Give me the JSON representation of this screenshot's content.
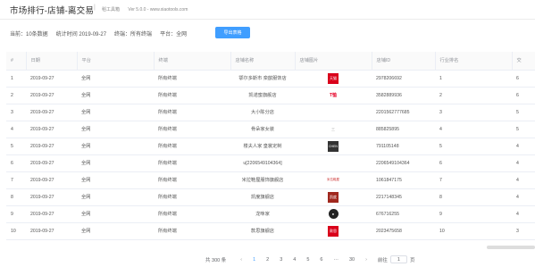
{
  "header": {
    "title": "市场排行-店铺-离交易",
    "separator": "|",
    "tool_name": "稻工具箱",
    "version": "Ver 5.0.0 - www.xiaotools.com"
  },
  "summary": {
    "current": "当前：10条数据",
    "stat_time": "统计时间 2019-09-27",
    "terminal": "终端：所有终端",
    "platform": "平台：全网",
    "export_label": "导出表格"
  },
  "table": {
    "columns": [
      "#",
      "日期",
      "平台",
      "终端",
      "店铺名称",
      "店铺图片",
      "店铺ID",
      "行业排名",
      "交"
    ],
    "rows": [
      {
        "idx": "1",
        "date": "2019-09-27",
        "platform": "全网",
        "terminal": "所有终端",
        "shop": "鄂尔多斯市 栾歆服饰店",
        "logo": "天猫",
        "logo_style": "red",
        "shop_id": "2978206692",
        "rank": "1",
        "extra": "6"
      },
      {
        "idx": "2",
        "date": "2019-09-27",
        "platform": "全网",
        "terminal": "所有终端",
        "shop": "凯诺蜜旗舰店",
        "logo": "T恤",
        "logo_style": "pink",
        "shop_id": "3582889936",
        "rank": "2",
        "extra": "6"
      },
      {
        "idx": "3",
        "date": "2019-09-27",
        "platform": "全网",
        "terminal": "所有终端",
        "shop": "大小陈分店",
        "logo": "",
        "logo_style": "none",
        "shop_id": "2201562777685",
        "rank": "3",
        "extra": "5"
      },
      {
        "idx": "4",
        "date": "2019-09-27",
        "platform": "全网",
        "terminal": "所有终端",
        "shop": "骨朵家女装",
        "logo": "三",
        "logo_style": "gray",
        "shop_id": "885825895",
        "rank": "4",
        "extra": "5"
      },
      {
        "idx": "5",
        "date": "2019-09-27",
        "platform": "全网",
        "terminal": "所有终端",
        "shop": "楼夫人家 皇裳定制",
        "logo": "CHEN",
        "logo_style": "dark",
        "shop_id": "791105148",
        "rank": "5",
        "extra": "4"
      },
      {
        "idx": "6",
        "date": "2019-09-27",
        "platform": "全网",
        "terminal": "所有终端",
        "shop": "u[2206549104364]",
        "logo": "",
        "logo_style": "none",
        "shop_id": "2206549104364",
        "rank": "6",
        "extra": "4"
      },
      {
        "idx": "7",
        "date": "2019-09-27",
        "platform": "全网",
        "terminal": "所有终端",
        "shop": "米拉鞋屋服饰旗舰店",
        "logo": "米拉鞋屋",
        "logo_style": "tiny",
        "shop_id": "1061847175",
        "rank": "7",
        "extra": "4"
      },
      {
        "idx": "8",
        "date": "2019-09-27",
        "platform": "全网",
        "terminal": "所有终端",
        "shop": "凯度旗舰店",
        "logo": "凯度",
        "logo_style": "brown",
        "shop_id": "2217148345",
        "rank": "8",
        "extra": "4"
      },
      {
        "idx": "9",
        "date": "2019-09-27",
        "platform": "全网",
        "terminal": "所有终端",
        "shop": "龙咪家",
        "logo": "●",
        "logo_style": "paw",
        "shop_id": "676716255",
        "rank": "9",
        "extra": "4"
      },
      {
        "idx": "10",
        "date": "2019-09-27",
        "platform": "全网",
        "terminal": "所有终端",
        "shop": "款思旗舰店",
        "logo": "款思",
        "logo_style": "red",
        "shop_id": "2023475658",
        "rank": "10",
        "extra": "3"
      }
    ]
  },
  "pagination": {
    "total": "共 300 条",
    "prev": "‹",
    "pages": [
      "1",
      "2",
      "3",
      "4",
      "5",
      "6"
    ],
    "ellipsis": "···",
    "last": "30",
    "next": "›",
    "goto_prefix": "前往",
    "goto_value": "1",
    "goto_suffix": "页",
    "active_page": "1"
  }
}
